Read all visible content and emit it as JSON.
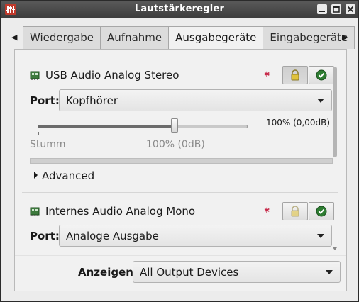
{
  "window": {
    "title": "Lautstärkeregler",
    "app_icon": "mixer-icon",
    "controls": [
      "minimize-icon",
      "maximize-icon",
      "close-icon"
    ]
  },
  "tabs": [
    {
      "label": "Wiedergabe",
      "active": false
    },
    {
      "label": "Aufnahme",
      "active": false
    },
    {
      "label": "Ausgabegeräte",
      "active": true
    },
    {
      "label": "Eingabegeräte",
      "active": false
    }
  ],
  "devices": [
    {
      "name": "USB Audio Analog Stereo",
      "icon": "sound-card-icon",
      "port_label": "Port:",
      "port_value": "Kopfhörer",
      "volume_readout": "100% (0,00dB)",
      "volume_fraction": 1.0,
      "mark_mute": "Stumm",
      "mark_100": "100% (0dB)",
      "expander_label": "Advanced",
      "lock_pressed": true
    },
    {
      "name": "Internes Audio Analog Mono",
      "icon": "sound-card-icon",
      "port_label": "Port:",
      "port_value": "Analoge Ausgabe",
      "lock_pressed": false
    }
  ],
  "footer": {
    "show_label": "Anzeigen:",
    "show_value": "All Output Devices"
  },
  "colors": {
    "titlebar": "#3c3c3c",
    "mute_indicator": "#c72a4a",
    "default_check": "#2e7d32",
    "lock": "#e0c23a"
  }
}
